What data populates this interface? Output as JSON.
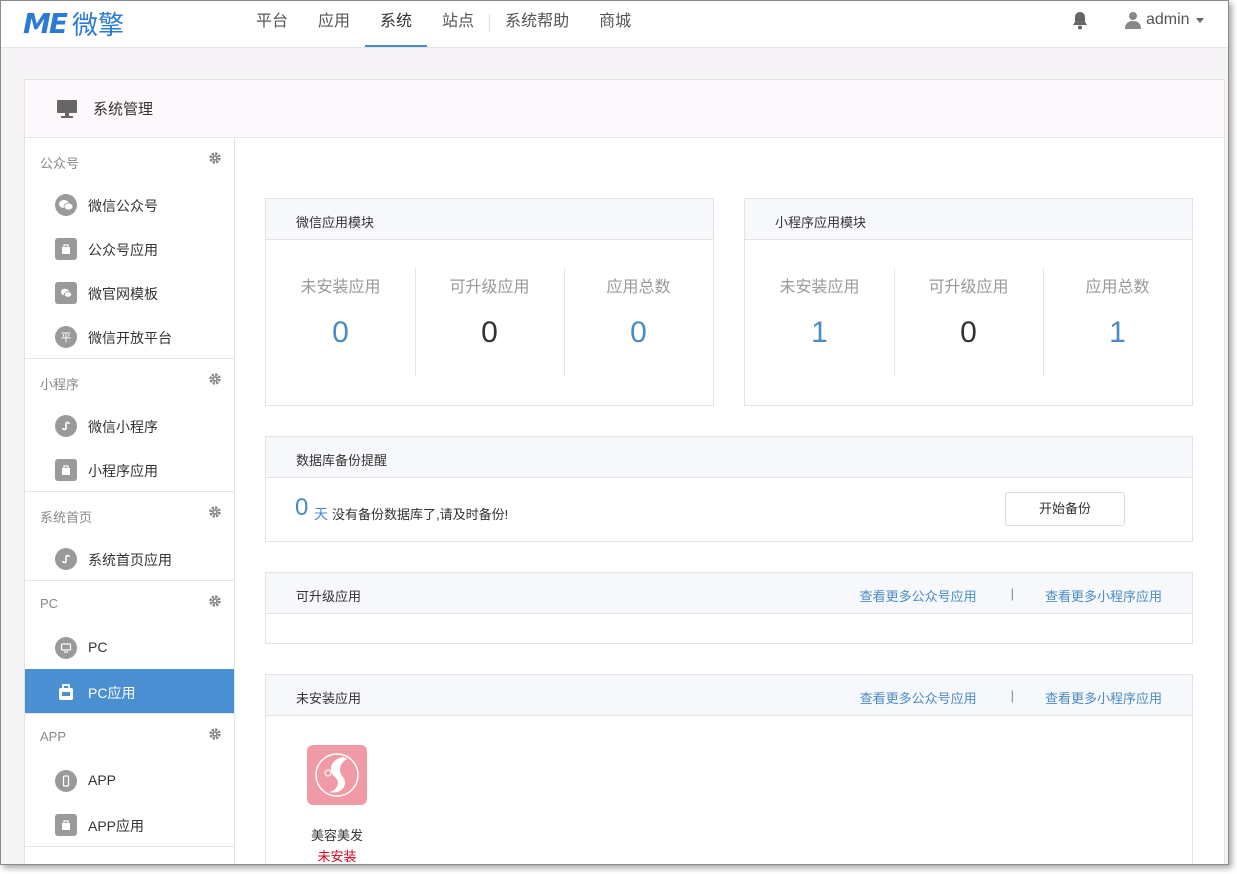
{
  "logo": {
    "mark": "ME",
    "text": "微擎"
  },
  "nav": {
    "items": [
      "平台",
      "应用",
      "系统",
      "站点"
    ],
    "items2": [
      "系统帮助",
      "商城"
    ]
  },
  "user": {
    "name": "admin"
  },
  "panel": {
    "title": "系统管理"
  },
  "sidebar": {
    "groups": [
      {
        "label": "公众号",
        "items": [
          "微信公众号",
          "公众号应用",
          "微官网模板",
          "微信开放平台"
        ]
      },
      {
        "label": "小程序",
        "items": [
          "微信小程序",
          "小程序应用"
        ]
      },
      {
        "label": "系统首页",
        "items": [
          "系统首页应用"
        ]
      },
      {
        "label": "PC",
        "items": [
          "PC",
          "PC应用"
        ]
      },
      {
        "label": "APP",
        "items": [
          "APP",
          "APP应用"
        ]
      }
    ],
    "icon_glyph_open_platform": "平"
  },
  "wechat_module": {
    "title": "微信应用模块",
    "stats": [
      {
        "label": "未安装应用",
        "value": "0"
      },
      {
        "label": "可升级应用",
        "value": "0"
      },
      {
        "label": "应用总数",
        "value": "0"
      }
    ]
  },
  "miniapp_module": {
    "title": "小程序应用模块",
    "stats": [
      {
        "label": "未安装应用",
        "value": "1"
      },
      {
        "label": "可升级应用",
        "value": "0"
      },
      {
        "label": "应用总数",
        "value": "1"
      }
    ]
  },
  "backup": {
    "title": "数据库备份提醒",
    "days": "0",
    "unit": "天",
    "message": "没有备份数据库了,请及时备份!",
    "button": "开始备份"
  },
  "upgradable": {
    "title": "可升级应用",
    "link1": "查看更多公众号应用",
    "sep": "|",
    "link2": "查看更多小程序应用"
  },
  "uninstalled": {
    "title": "未安装应用",
    "link1": "查看更多公众号应用",
    "sep": "|",
    "link2": "查看更多小程序应用",
    "app": {
      "name": "美容美发",
      "status": "未安装"
    }
  },
  "colors": {
    "accent": "#4a8bc6",
    "active_bg": "#4a8fd1",
    "danger": "#d9001b"
  }
}
